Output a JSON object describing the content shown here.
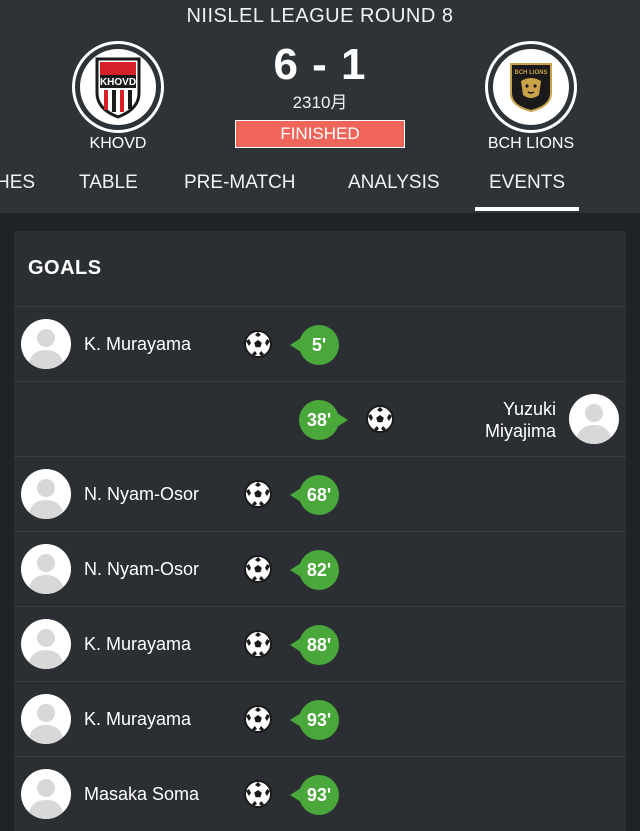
{
  "match": {
    "round_title": "NIISLEL LEAGUE ROUND 8",
    "score": "6 - 1",
    "date": "2310月",
    "status": "FINISHED",
    "home_team": "KHOVD",
    "away_team": "BCH LIONS",
    "home_logo_text": "KHOVD",
    "away_logo_text": "BCH LIONS"
  },
  "tabs": [
    "HES",
    "TABLE",
    "PRE-MATCH",
    "ANALYSIS",
    "EVENTS"
  ],
  "active_tab": "EVENTS",
  "goals": {
    "title": "GOALS",
    "events": [
      {
        "player": "K. Murayama",
        "minute": "5'",
        "side": "home"
      },
      {
        "player": "Yuzuki Miyajima",
        "player_line1": "Yuzuki",
        "player_line2": "Miyajima",
        "minute": "38'",
        "side": "away"
      },
      {
        "player": "N. Nyam-Osor",
        "minute": "68'",
        "side": "home"
      },
      {
        "player": "N. Nyam-Osor",
        "minute": "82'",
        "side": "home"
      },
      {
        "player": "K. Murayama",
        "minute": "88'",
        "side": "home"
      },
      {
        "player": "K. Murayama",
        "minute": "93'",
        "side": "home"
      },
      {
        "player": "Masaka Soma",
        "minute": "93'",
        "side": "home"
      }
    ]
  },
  "icons": {
    "ball": "soccer-ball-icon",
    "avatar": "player-avatar-icon"
  },
  "colors": {
    "header_bg": "#2e3337",
    "page_bg": "#1f2326",
    "card_bg": "#2b2f33",
    "status_bg": "#f0655a",
    "minute_bg": "#4aa73a",
    "khovd_red": "#d61f26"
  }
}
